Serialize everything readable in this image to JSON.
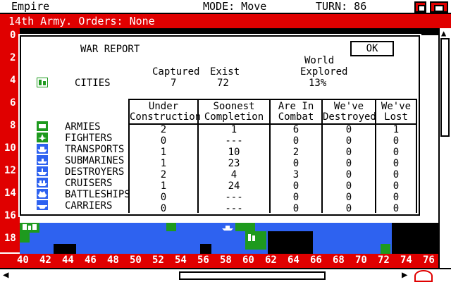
{
  "menubar": {
    "app_title": "Empire",
    "mode": "MODE: Move",
    "turn": "TURN: 86"
  },
  "titlebar": {
    "text": "14th Army. Orders: None"
  },
  "row_ruler": [
    "0",
    "2",
    "4",
    "6",
    "8",
    "10",
    "12",
    "14",
    "16",
    "18"
  ],
  "col_ruler": [
    "40",
    "42",
    "44",
    "46",
    "48",
    "50",
    "52",
    "54",
    "56",
    "58",
    "60",
    "62",
    "64",
    "66",
    "68",
    "70",
    "72",
    "74",
    "76"
  ],
  "dialog": {
    "title": "WAR REPORT",
    "ok_label": "OK",
    "cities": {
      "label": "CITIES",
      "captured_header": "Captured",
      "exist_header": "Exist",
      "world_header_1": "World",
      "world_header_2": "Explored",
      "captured": "7",
      "exist": "72",
      "explored": "13%"
    },
    "columns": [
      {
        "h1": "Under",
        "h2": "Construction"
      },
      {
        "h1": "Soonest",
        "h2": "Completion"
      },
      {
        "h1": "Are In",
        "h2": "Combat"
      },
      {
        "h1": "We've",
        "h2": "Destroyed"
      },
      {
        "h1": "We've",
        "h2": "Lost"
      }
    ],
    "units": [
      {
        "name": "ARMIES",
        "icon": "army-icon",
        "values": [
          "2",
          "1",
          "6",
          "0",
          "1"
        ]
      },
      {
        "name": "FIGHTERS",
        "icon": "fighter-icon",
        "values": [
          "0",
          "---",
          "0",
          "0",
          "0"
        ]
      },
      {
        "name": "TRANSPORTS",
        "icon": "transport-icon",
        "values": [
          "1",
          "10",
          "2",
          "0",
          "0"
        ]
      },
      {
        "name": "SUBMARINES",
        "icon": "submarine-icon",
        "values": [
          "1",
          "23",
          "0",
          "0",
          "0"
        ]
      },
      {
        "name": "DESTROYERS",
        "icon": "destroyer-icon",
        "values": [
          "2",
          "4",
          "3",
          "0",
          "0"
        ]
      },
      {
        "name": "CRUISERS",
        "icon": "cruiser-icon",
        "values": [
          "1",
          "24",
          "0",
          "0",
          "0"
        ]
      },
      {
        "name": "BATTLESHIPS",
        "icon": "battleship-icon",
        "values": [
          "0",
          "---",
          "0",
          "0",
          "0"
        ]
      },
      {
        "name": "CARRIERS",
        "icon": "carrier-icon",
        "values": [
          "0",
          "---",
          "0",
          "0",
          "0"
        ]
      }
    ]
  },
  "colors": {
    "red": "#e00000",
    "water": "#2e62f0",
    "land": "#1e9a1e"
  }
}
